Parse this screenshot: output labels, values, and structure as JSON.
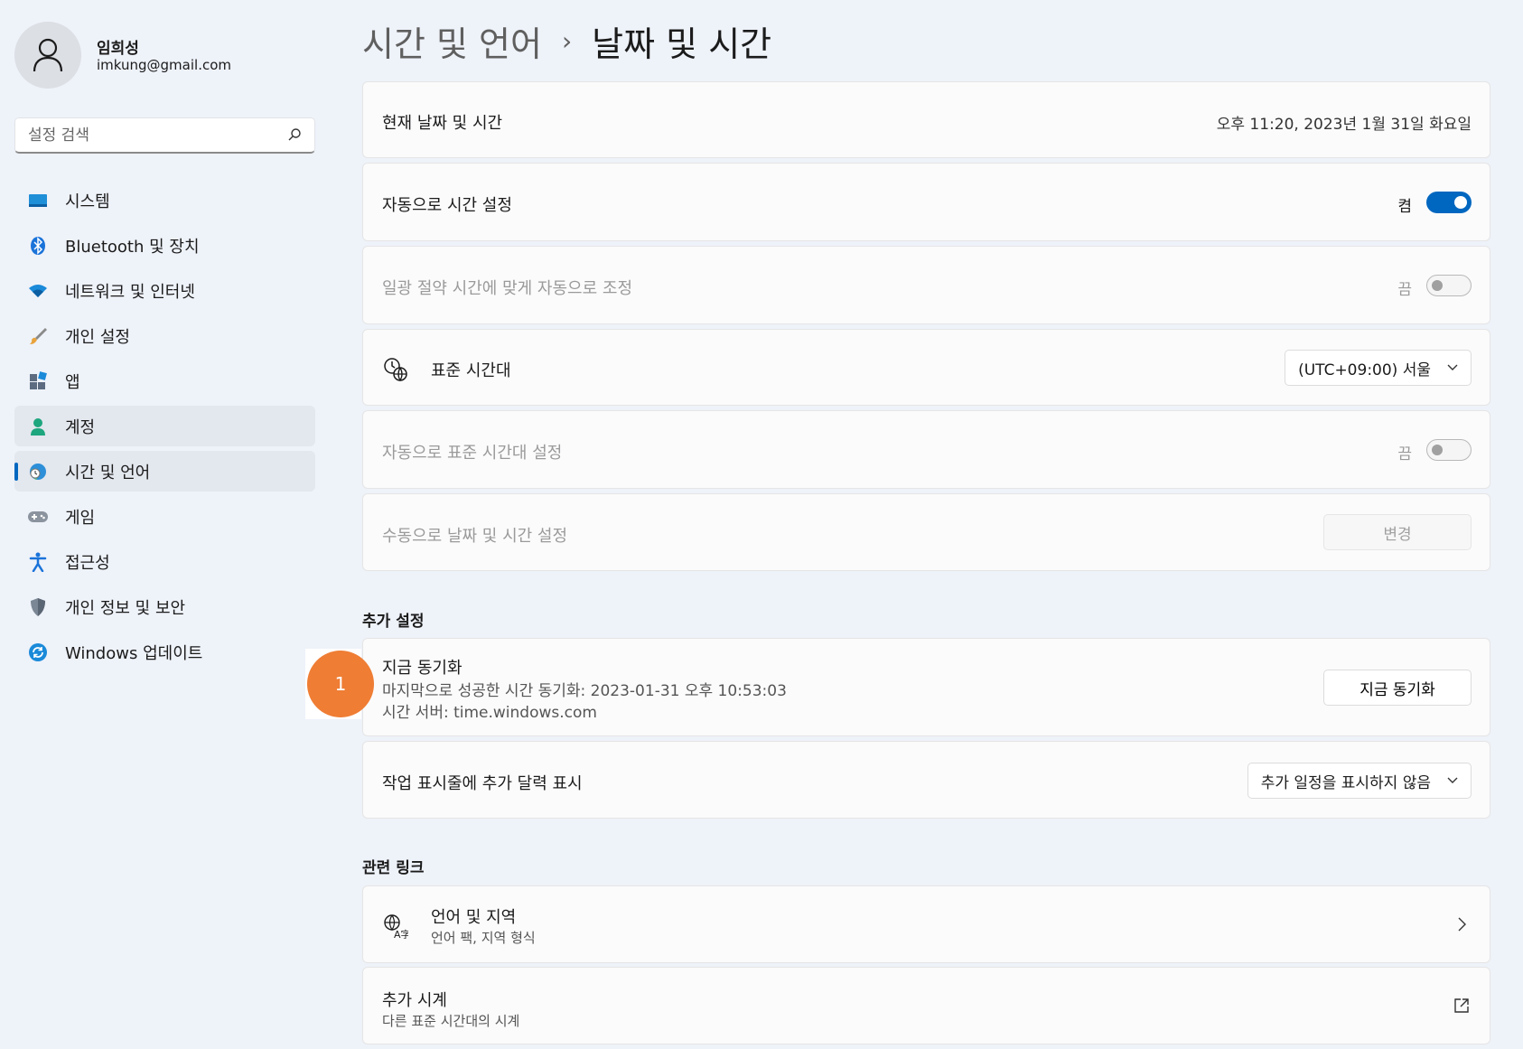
{
  "user": {
    "name": "임희성",
    "email": "imkung@gmail.com"
  },
  "search": {
    "placeholder": "설정 검색"
  },
  "sidebar": {
    "items": [
      {
        "label": "시스템",
        "icon": "system-icon"
      },
      {
        "label": "Bluetooth 및 장치",
        "icon": "bluetooth-icon"
      },
      {
        "label": "네트워크 및 인터넷",
        "icon": "wifi-icon"
      },
      {
        "label": "개인 설정",
        "icon": "brush-icon"
      },
      {
        "label": "앱",
        "icon": "apps-icon"
      },
      {
        "label": "계정",
        "icon": "account-icon"
      },
      {
        "label": "시간 및 언어",
        "icon": "time-language-icon",
        "selected": true
      },
      {
        "label": "게임",
        "icon": "gamepad-icon"
      },
      {
        "label": "접근성",
        "icon": "accessibility-icon"
      },
      {
        "label": "개인 정보 및 보안",
        "icon": "shield-icon"
      },
      {
        "label": "Windows 업데이트",
        "icon": "update-icon"
      }
    ]
  },
  "breadcrumb": {
    "parent": "시간 및 언어",
    "separator": "›",
    "current": "날짜 및 시간"
  },
  "current_datetime": {
    "label": "현재 날짜 및 시간",
    "value": "오후 11:20, 2023년 1월 31일 화요일"
  },
  "auto_time": {
    "label": "자동으로 시간 설정",
    "state": "켬",
    "on": true
  },
  "dst": {
    "label": "일광 절약 시간에 맞게 자동으로 조정",
    "state": "끔",
    "on": false
  },
  "timezone": {
    "label": "표준 시간대",
    "value": "(UTC+09:00) 서울"
  },
  "auto_timezone": {
    "label": "자동으로 표준 시간대 설정",
    "state": "끔",
    "on": false
  },
  "manual": {
    "label": "수동으로 날짜 및 시간 설정",
    "button": "변경"
  },
  "additional": {
    "title": "추가 설정",
    "sync": {
      "label": "지금 동기화",
      "last_sync": "마지막으로 성공한 시간 동기화: 2023-01-31 오후 10:53:03",
      "server": "시간 서버: time.windows.com",
      "button": "지금 동기화"
    },
    "calendar": {
      "label": "작업 표시줄에 추가 달력 표시",
      "value": "추가 일정을 표시하지 않음"
    }
  },
  "related": {
    "title": "관련 링크",
    "language_region": {
      "label": "언어 및 지역",
      "sub": "언어 팩, 지역 형식"
    },
    "additional_clocks": {
      "label": "추가 시계",
      "sub": "다른 표준 시간대의 시계"
    }
  },
  "annotation": {
    "number": "1"
  },
  "colors": {
    "accent": "#0067c0",
    "annotation": "#ef7d34"
  }
}
